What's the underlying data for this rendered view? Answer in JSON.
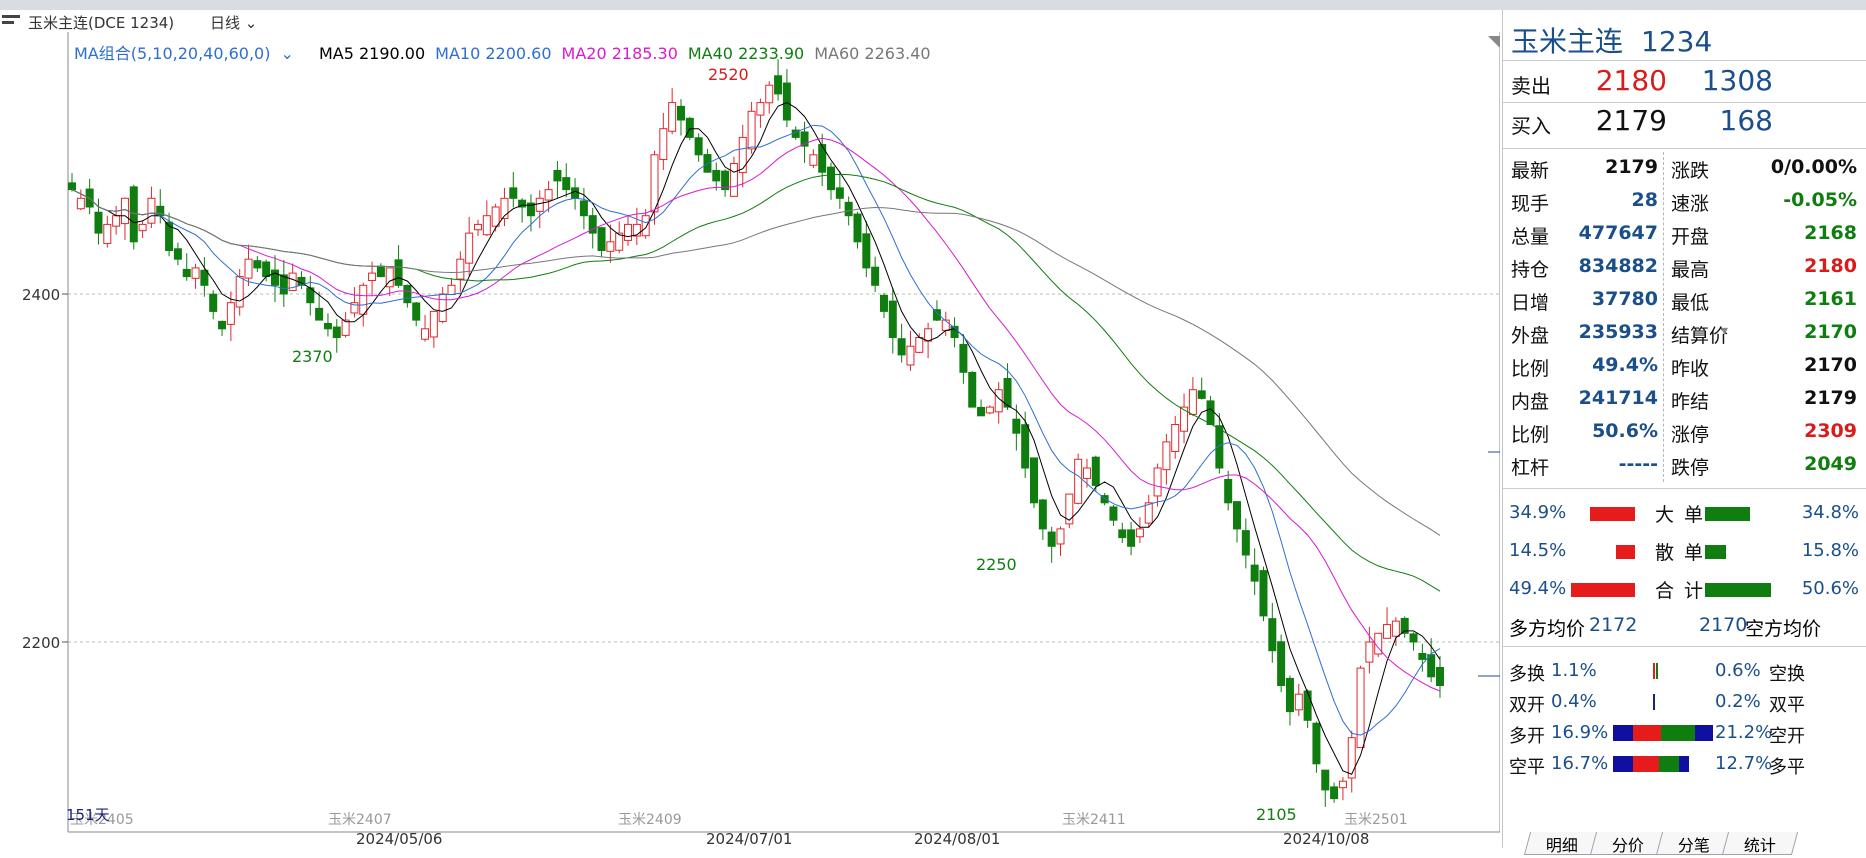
{
  "title_bar": {
    "symbol": "玉米主连(DCE 1234)",
    "period": "日线",
    "period_arrow": "chevron-down-icon"
  },
  "ma_legend": {
    "group": "MA组合(5,10,20,40,60,0)",
    "group_arrow": "chevron-down-icon",
    "items": [
      {
        "label": "MA5 2190.00",
        "color": "#000000"
      },
      {
        "label": "MA10 2200.60",
        "color": "#2e6fcf"
      },
      {
        "label": "MA20 2185.30",
        "color": "#d81bd1"
      },
      {
        "label": "MA40 2233.90",
        "color": "#0f7d0f"
      },
      {
        "label": "MA60 2263.40",
        "color": "#777777"
      }
    ]
  },
  "chart_data": {
    "type": "candlestick",
    "y_ticks": [
      "2400",
      "2200"
    ],
    "x_ticks": [
      "2024/05/06",
      "2024/07/01",
      "2024/08/01",
      "2024/10/08"
    ],
    "contract_marks": [
      "玉米2405",
      "玉米2407",
      "玉米2409",
      "玉米2411",
      "玉米2501"
    ],
    "annotations": [
      "2520",
      "2370",
      "2250",
      "2105"
    ],
    "day_count": "151天",
    "up_color": "#e0272c",
    "down_color": "#0f7d0f",
    "close_series": [
      2460,
      2455,
      2450,
      2435,
      2440,
      2445,
      2455,
      2430,
      2440,
      2455,
      2445,
      2425,
      2420,
      2410,
      2415,
      2405,
      2390,
      2380,
      2395,
      2410,
      2420,
      2415,
      2410,
      2405,
      2400,
      2412,
      2405,
      2395,
      2385,
      2380,
      2375,
      2385,
      2395,
      2405,
      2412,
      2410,
      2415,
      2405,
      2395,
      2385,
      2380,
      2390,
      2400,
      2405,
      2420,
      2435,
      2440,
      2445,
      2450,
      2455,
      2455,
      2450,
      2445,
      2455,
      2460,
      2465,
      2460,
      2455,
      2445,
      2435,
      2425,
      2430,
      2435,
      2440,
      2440,
      2445,
      2480,
      2495,
      2510,
      2500,
      2490,
      2480,
      2470,
      2465,
      2460,
      2475,
      2490,
      2505,
      2510,
      2520,
      2515,
      2500,
      2490,
      2485,
      2480,
      2470,
      2460,
      2455,
      2445,
      2430,
      2415,
      2405,
      2390,
      2375,
      2365,
      2370,
      2375,
      2380,
      2385,
      2385,
      2375,
      2355,
      2335,
      2330,
      2335,
      2345,
      2335,
      2320,
      2300,
      2280,
      2265,
      2255,
      2265,
      2285,
      2305,
      2300,
      2290,
      2280,
      2270,
      2260,
      2255,
      2265,
      2280,
      2300,
      2315,
      2325,
      2335,
      2345,
      2340,
      2325,
      2300,
      2280,
      2265,
      2250,
      2235,
      2215,
      2195,
      2175,
      2160,
      2170,
      2155,
      2130,
      2115,
      2110,
      2120,
      2145,
      2185,
      2200,
      2205,
      2210,
      2212,
      2205,
      2200,
      2190,
      2180,
      2175
    ]
  },
  "right_panel": {
    "name": "玉米主连",
    "code": "1234",
    "sell": {
      "label": "卖出",
      "price": "2180",
      "vol": "1308"
    },
    "buy": {
      "label": "买入",
      "price": "2179",
      "vol": "168"
    },
    "rows": [
      {
        "l1": "最新",
        "v1": "2179",
        "v1c": "#111111",
        "l2": "涨跌",
        "v2": "0/0.00%",
        "v2c": "#111111"
      },
      {
        "l1": "现手",
        "v1": "28",
        "v1c": "#1a4f8b",
        "l2": "速涨",
        "v2": "-0.05%",
        "v2c": "#0f7d0f"
      },
      {
        "l1": "总量",
        "v1": "477647",
        "v1c": "#1a4f8b",
        "l2": "开盘",
        "v2": "2168",
        "v2c": "#0f7d0f"
      },
      {
        "l1": "持仓",
        "v1": "834882",
        "v1c": "#1a4f8b",
        "l2": "最高",
        "v2": "2180",
        "v2c": "#d81b1b"
      },
      {
        "l1": "日增",
        "v1": "37780",
        "v1c": "#1a4f8b",
        "l2": "最低",
        "v2": "2161",
        "v2c": "#0f7d0f"
      },
      {
        "l1": "外盘",
        "v1": "235933",
        "v1c": "#1a4f8b",
        "l2": "结算价",
        "v2": "2170",
        "v2c": "#0f7d0f"
      },
      {
        "l1": "比例",
        "v1": "49.4%",
        "v1c": "#1a4f8b",
        "l2": "昨收",
        "v2": "2170",
        "v2c": "#111111"
      },
      {
        "l1": "内盘",
        "v1": "241714",
        "v1c": "#1a4f8b",
        "l2": "昨结",
        "v2": "2179",
        "v2c": "#111111"
      },
      {
        "l1": "比例",
        "v1": "50.6%",
        "v1c": "#1a4f8b",
        "l2": "涨停",
        "v2": "2309",
        "v2c": "#d81b1b"
      },
      {
        "l1": "杠杆",
        "v1": "-----",
        "v1c": "#1a4f8b",
        "l2": "跌停",
        "v2": "2049",
        "v2c": "#0f7d0f"
      }
    ],
    "flows": [
      {
        "left": "34.9%",
        "label": "大 单",
        "right": "34.8%",
        "red": 0.349,
        "green": 0.348
      },
      {
        "left": "14.5%",
        "label": "散 单",
        "right": "15.8%",
        "red": 0.145,
        "green": 0.158
      },
      {
        "left": "49.4%",
        "label": "合 计",
        "right": "50.6%",
        "red": 0.494,
        "green": 0.506
      }
    ],
    "avg": {
      "left_label": "多方均价",
      "left_val": "2172",
      "right_val": "2170",
      "right_label": "空方均价"
    },
    "changes": [
      {
        "l_label": "多换",
        "l_val": "1.1%",
        "r_val": "0.6%",
        "r_label": "空换"
      },
      {
        "l_label": "双开",
        "l_val": "0.4%",
        "r_val": "0.2%",
        "r_label": "双平"
      },
      {
        "l_label": "多开",
        "l_val": "16.9%",
        "r_val": "21.2%",
        "r_label": "空开"
      },
      {
        "l_label": "空平",
        "l_val": "16.7%",
        "r_val": "12.7%",
        "r_label": "多平"
      }
    ],
    "tabs": [
      "明细",
      "分价",
      "分笔",
      "统计"
    ]
  }
}
